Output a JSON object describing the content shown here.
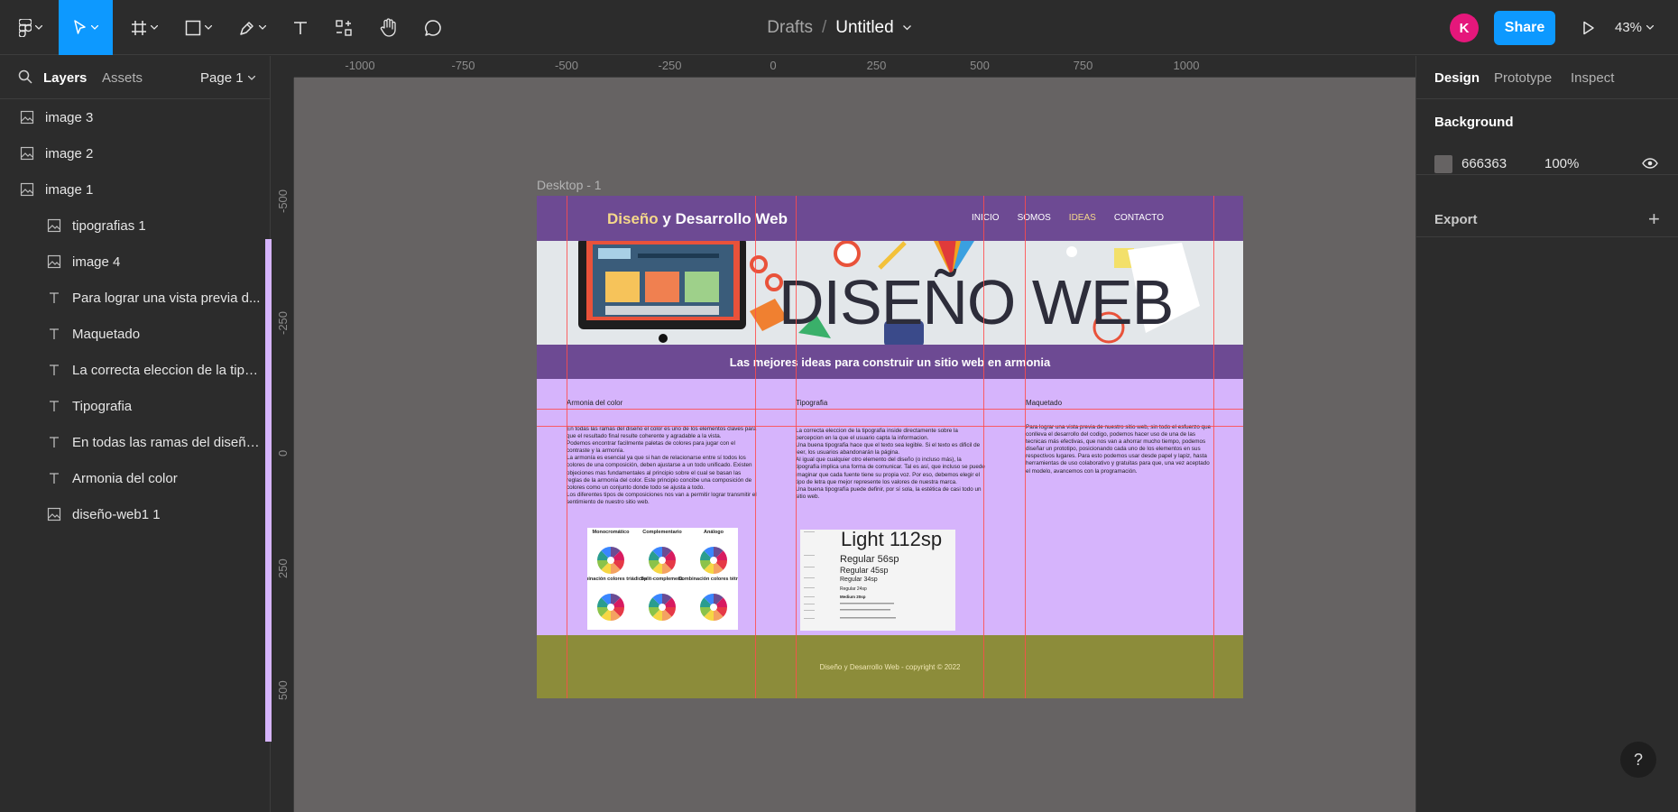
{
  "toolbar": {
    "breadcrumb": {
      "folder": "Drafts",
      "separator": "/",
      "file": "Untitled"
    },
    "avatar_initial": "K",
    "share_label": "Share",
    "zoom": "43%"
  },
  "left_panel": {
    "tabs": {
      "layers": "Layers",
      "assets": "Assets"
    },
    "page_selector": "Page 1",
    "layers": [
      {
        "name": "image 3",
        "type": "image"
      },
      {
        "name": "image 2",
        "type": "image"
      },
      {
        "name": "image 1",
        "type": "image"
      },
      {
        "name": "Desktop - 1",
        "type": "frame"
      },
      {
        "name": "tipografias 1",
        "type": "image"
      },
      {
        "name": "image 4",
        "type": "image"
      },
      {
        "name": "Para lograr una vista previa d...",
        "type": "text"
      },
      {
        "name": "Maquetado",
        "type": "text"
      },
      {
        "name": "La correcta eleccion de la tipo...",
        "type": "text"
      },
      {
        "name": "Tipografia",
        "type": "text"
      },
      {
        "name": "En todas las ramas del diseño...",
        "type": "text"
      },
      {
        "name": "Armonia del color",
        "type": "text"
      },
      {
        "name": "diseño-web1 1",
        "type": "image"
      }
    ]
  },
  "canvas": {
    "background": "#666363",
    "ruler_top": [
      "-1000",
      "-750",
      "-500",
      "-250",
      "0",
      "250",
      "500",
      "750",
      "1000"
    ],
    "ruler_left": [
      "-500",
      "-250",
      "0",
      "250",
      "500"
    ],
    "frame_label": "Desktop - 1",
    "site": {
      "logo_accent": "Diseño",
      "logo_rest": "y Desarrollo Web",
      "nav": [
        "INICIO",
        "SOMOS",
        "IDEAS",
        "CONTACTO"
      ],
      "hero_text": "DISEÑO WEB",
      "band_text": "Las mejores ideas para construir un sitio web en armonia",
      "columns": [
        {
          "title": "Armonia del color",
          "body": "En todas las ramas del diseño el color es uno de los elementos claves para que el resultado final resulte coherente y agradable a la vista.\nPodemos encontrar facilmente paletas de colores para jugar con el contraste y la armonía.\nLa armonía es esencial ya que si han de relacionarse entre sí todos los colores de una composición, deben ajustarse a un todo unificado. Existen objeciones mas fundamentales al principio sobre el cual se basan las reglas de la armonía del color. Este principio concibe una composición de colores como un conjunto donde todo se ajusta a todo.\nLos diferentes tipos de composiciones nos van a permitir lograr transmitir el sentimiento de nuestro sitio web."
        },
        {
          "title": "Tipografia",
          "body": "La correcta eleccion de la tipografia inside directamente sobre la percepcion en la que el usuario capta la informacion.\nUna buena tipografia hace que el texto sea legible. Si el texto es dificil de leer, los usuarios abandonarán la página.\nAl igual que cualquier otro elemento del diseño (o incluso más), la tipografía implica una forma de comunicar. Tal es así, que incluso se puede imaginar que cada fuente tiene su propia voz. Por eso, debemos elegir el tipo de letra que mejor represente los valores de nuestra marca.\nUna buena tipografía puede definir, por sí sola, la estética de casi todo un sitio web."
        },
        {
          "title": "Maquetado",
          "body": "Para lograr una vista previa de nuestro sitio web, sin todo el esfuerzo que conlleva el desarrollo del codigo, podemos hacer uso de una de las tecnicas más efectivas, que nos van a ahorrar mucho tiempo, podemos diseñar un prototipo, posicionando cada uno de los elementos en sus respectivos lugares. Para esto podemos usar desde papel y lapiz, hasta herramientas de uso colaborativo y gratuitas para que, una vez aceptado el modelo, avancemos con la programación."
        }
      ],
      "wheels": {
        "labels": [
          "Monocromático",
          "Complementario",
          "Análogo",
          "Combinación colores triádicos",
          "Split-complement.",
          "Combinación colores tétradas"
        ]
      },
      "type_scale": {
        "title": "Light 112sp",
        "rows": [
          "Regular 56sp",
          "Regular 45sp",
          "Regular 34sp",
          "Regular 24sp",
          "Medium 20sp"
        ]
      },
      "footer": "Diseño y Desarrollo Web - copyright © 2022"
    }
  },
  "right_panel": {
    "tabs": {
      "design": "Design",
      "prototype": "Prototype",
      "inspect": "Inspect"
    },
    "background_heading": "Background",
    "background_hex": "666363",
    "background_opacity": "100%",
    "export_heading": "Export"
  },
  "help_label": "?"
}
